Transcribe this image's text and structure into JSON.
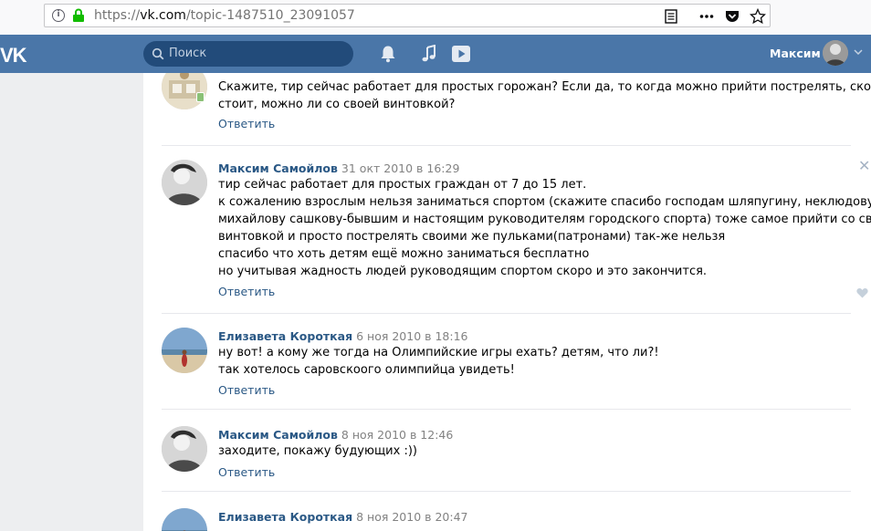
{
  "browser": {
    "url_prefix": "https://",
    "url_host": "vk.com",
    "url_path": "/topic-1487510_23091057"
  },
  "header": {
    "logo": "VK",
    "search_placeholder": "Поиск",
    "user_name": "Максим",
    "accent_color": "#4a76a8"
  },
  "posts": [
    {
      "author": "",
      "date": "",
      "text": [
        "Скажите, тир сейчас работает для простых горожан? Если да, то когда можно прийти пострелять, сколько это",
        "стоит, можно ли со своей винтовкой?"
      ],
      "reply": "Ответить"
    },
    {
      "author": "Максим Самойлов",
      "date": "31 окт 2010 в 16:29",
      "text": [
        "тир сейчас работает для простых граждан от 7 до 15 лет.",
        "к сожалению взрослым нельзя заниматься спортом (скажите спасибо господам шляпугину, неклюдову,",
        "михайлову сашкову-бывшим и настоящим руководителям городского спорта) тоже самое прийти со своей",
        "винтовкой и просто пострелять своими же пульками(патронами) так-же нельзя",
        "спасибо что хоть детям ещё можно заниматься бесплатно",
        "но учитывая жадность людей руководящим спортом скоро и это закончится."
      ],
      "reply": "Ответить"
    },
    {
      "author": "Елизавета Короткая",
      "date": "6 ноя 2010 в 18:16",
      "text": [
        "ну вот! а кому же тогда на Олимпийские игры ехать? детям, что ли?!",
        "так хотелось саровскоого олимпийца увидеть!"
      ],
      "reply": "Ответить"
    },
    {
      "author": "Максим Самойлов",
      "date": "8 ноя 2010 в 12:46",
      "text": [
        "заходите, покажу будующих :))"
      ],
      "reply": "Ответить"
    },
    {
      "author": "Елизавета Короткая",
      "date": "8 ноя 2010 в 20:47",
      "text": [],
      "reply": ""
    }
  ]
}
